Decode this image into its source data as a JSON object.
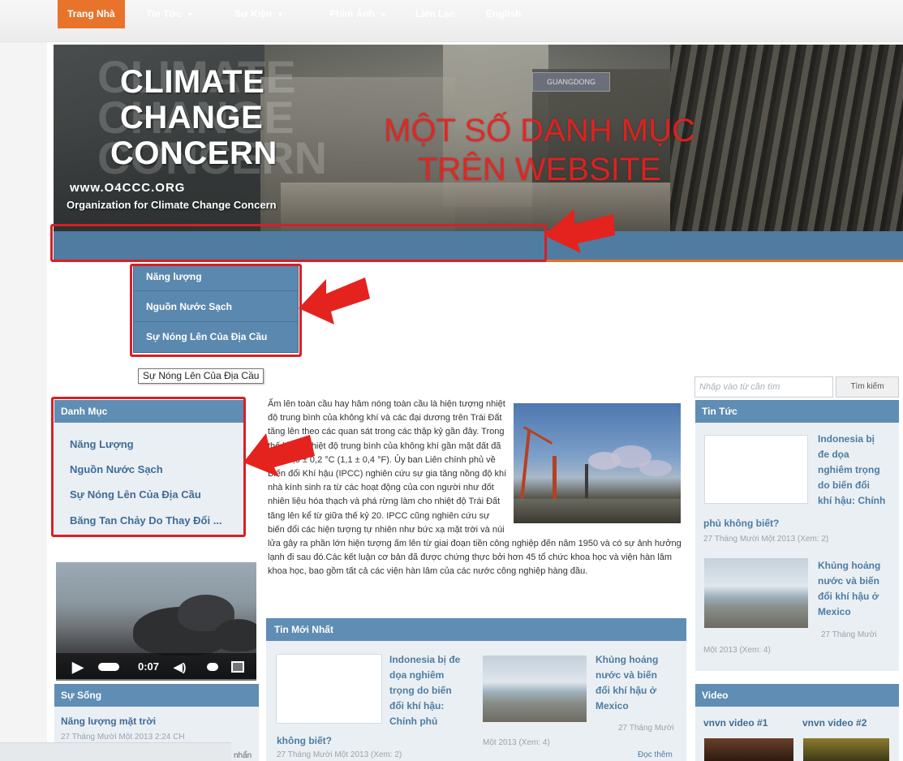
{
  "banner": {
    "logo_lines": [
      "CLIMATE",
      "CHANGE",
      "CONCERN"
    ],
    "url": "www.O4CCC.ORG",
    "org_name": "Organization for Climate Change Concern",
    "overlay_title_line1": "MỘT SỐ DANH MỤC",
    "overlay_title_line2": "TRÊN WEBSITE",
    "sign_text": "GUANGDONG"
  },
  "nav": {
    "items": [
      {
        "label": "Trang Nhà",
        "active": true
      },
      {
        "label": "Tin Tức",
        "has_dropdown": true
      },
      {
        "label": "Sự Kiện",
        "has_dropdown": true
      },
      {
        "label": "Phim Ảnh",
        "has_dropdown": true
      },
      {
        "label": "Liên Lạc"
      },
      {
        "label": "English"
      }
    ],
    "caret": "▼"
  },
  "dropdown": {
    "items": [
      "Năng lượng",
      "Nguồn Nước Sạch",
      "Sự Nóng Lên Của Địa Cầu"
    ]
  },
  "tooltip": "Sự Nóng Lên Của Địa Cầu",
  "left_sidebar": {
    "categories_title": "Danh Mục",
    "categories": [
      "Năng Lượng",
      "Nguồn Nước Sạch",
      "Sự Nóng Lên Của Địa Cầu",
      "Băng Tan Chảy Do Thay Đổi ..."
    ],
    "video_time": "0:07",
    "life_title": "Sự Sống",
    "life_link": "Năng lượng mặt trời",
    "life_meta": "27 Tháng Mười Một 2013 2:24 CH",
    "partial_text": "nhẩn"
  },
  "article": {
    "text": "Ấm lên toàn cầu hay hâm nóng toàn cầu là hiện tượng nhiệt độ trung bình của không khí và các đại dương trên Trái Đất tăng lên theo các quan sát trong các thập kỷ gần đây. Trong thế kỉ 20, nhiệt độ trung bình của không khí gần mặt đất đã tăng 0,6 ± 0,2 °C (1,1 ± 0,4 °F). Ủy ban Liên chính phủ về Biến đổi Khí hậu (IPCC) nghiên cứu sự gia tăng nồng độ khí nhà kính sinh ra từ các hoạt động của con người như đốt nhiên liệu hóa thạch và phá rừng làm cho nhiệt độ Trái Đất tăng lên kể từ giữa thế kỷ 20. IPCC cũng nghiên cứu sự biến đổi các hiện tượng tự nhiên như bức xạ mặt trời và núi lửa gây ra phần lớn hiện tượng ấm lên từ giai đoạn tiền công nghiệp đến năm 1950 và có sự ảnh hưởng lạnh đi sau đó.Các kết luận cơ bản đã được chứng thực bởi hơn 45 tổ chức khoa học và viện hàn lâm khoa học, bao gồm tất cả các viện hàn lâm của các nước công nghiệp hàng đầu."
  },
  "latest_news": {
    "title": "Tin Mới Nhất",
    "item1_title_lines": [
      "Indonesia bị đe",
      "dọa nghiêm",
      "trọng do biến",
      "đổi khí hậu:",
      "Chính phủ"
    ],
    "item1_title_tail": "không biết?",
    "item1_meta": "27 Tháng Mười Một 2013 (Xem: 2)",
    "item2_title_lines": [
      "Khủng hoảng",
      "nước và biến",
      "đổi khí hậu ở",
      "Mexico"
    ],
    "item2_meta_a": "27 Tháng Mười",
    "item2_meta_b": "Một 2013 (Xem: 4)",
    "read_more": "Đọc thêm"
  },
  "right_sidebar": {
    "search_placeholder": "Nhập vào từ cần tìm",
    "search_button": "Tìm kiếm",
    "news_title": "Tin Tức",
    "news1_lines": [
      "Indonesia bị",
      "đe dọa",
      "nghiêm trọng",
      "do biến đổi",
      "khí hậu: Chính"
    ],
    "news1_tail": "phủ không biết?",
    "news1_meta": "27 Tháng Mười Một 2013 (Xem: 2)",
    "news2_lines": [
      "Khủng hoảng",
      "nước và biến",
      "đổi khí hậu ở",
      "Mexico"
    ],
    "news2_meta_a": "27 Tháng Mười",
    "news2_meta_b": "Một 2013 (Xem: 4)",
    "video_title": "Video",
    "video1": "vnvn video #1",
    "video2": "vnvn video #2"
  },
  "colors": {
    "nav_blue": "#4f7ca0",
    "panel_blue": "#5f8db3",
    "active_orange": "#e8742c",
    "annotation_red": "#d81f26",
    "link_blue": "#3f6c95"
  }
}
